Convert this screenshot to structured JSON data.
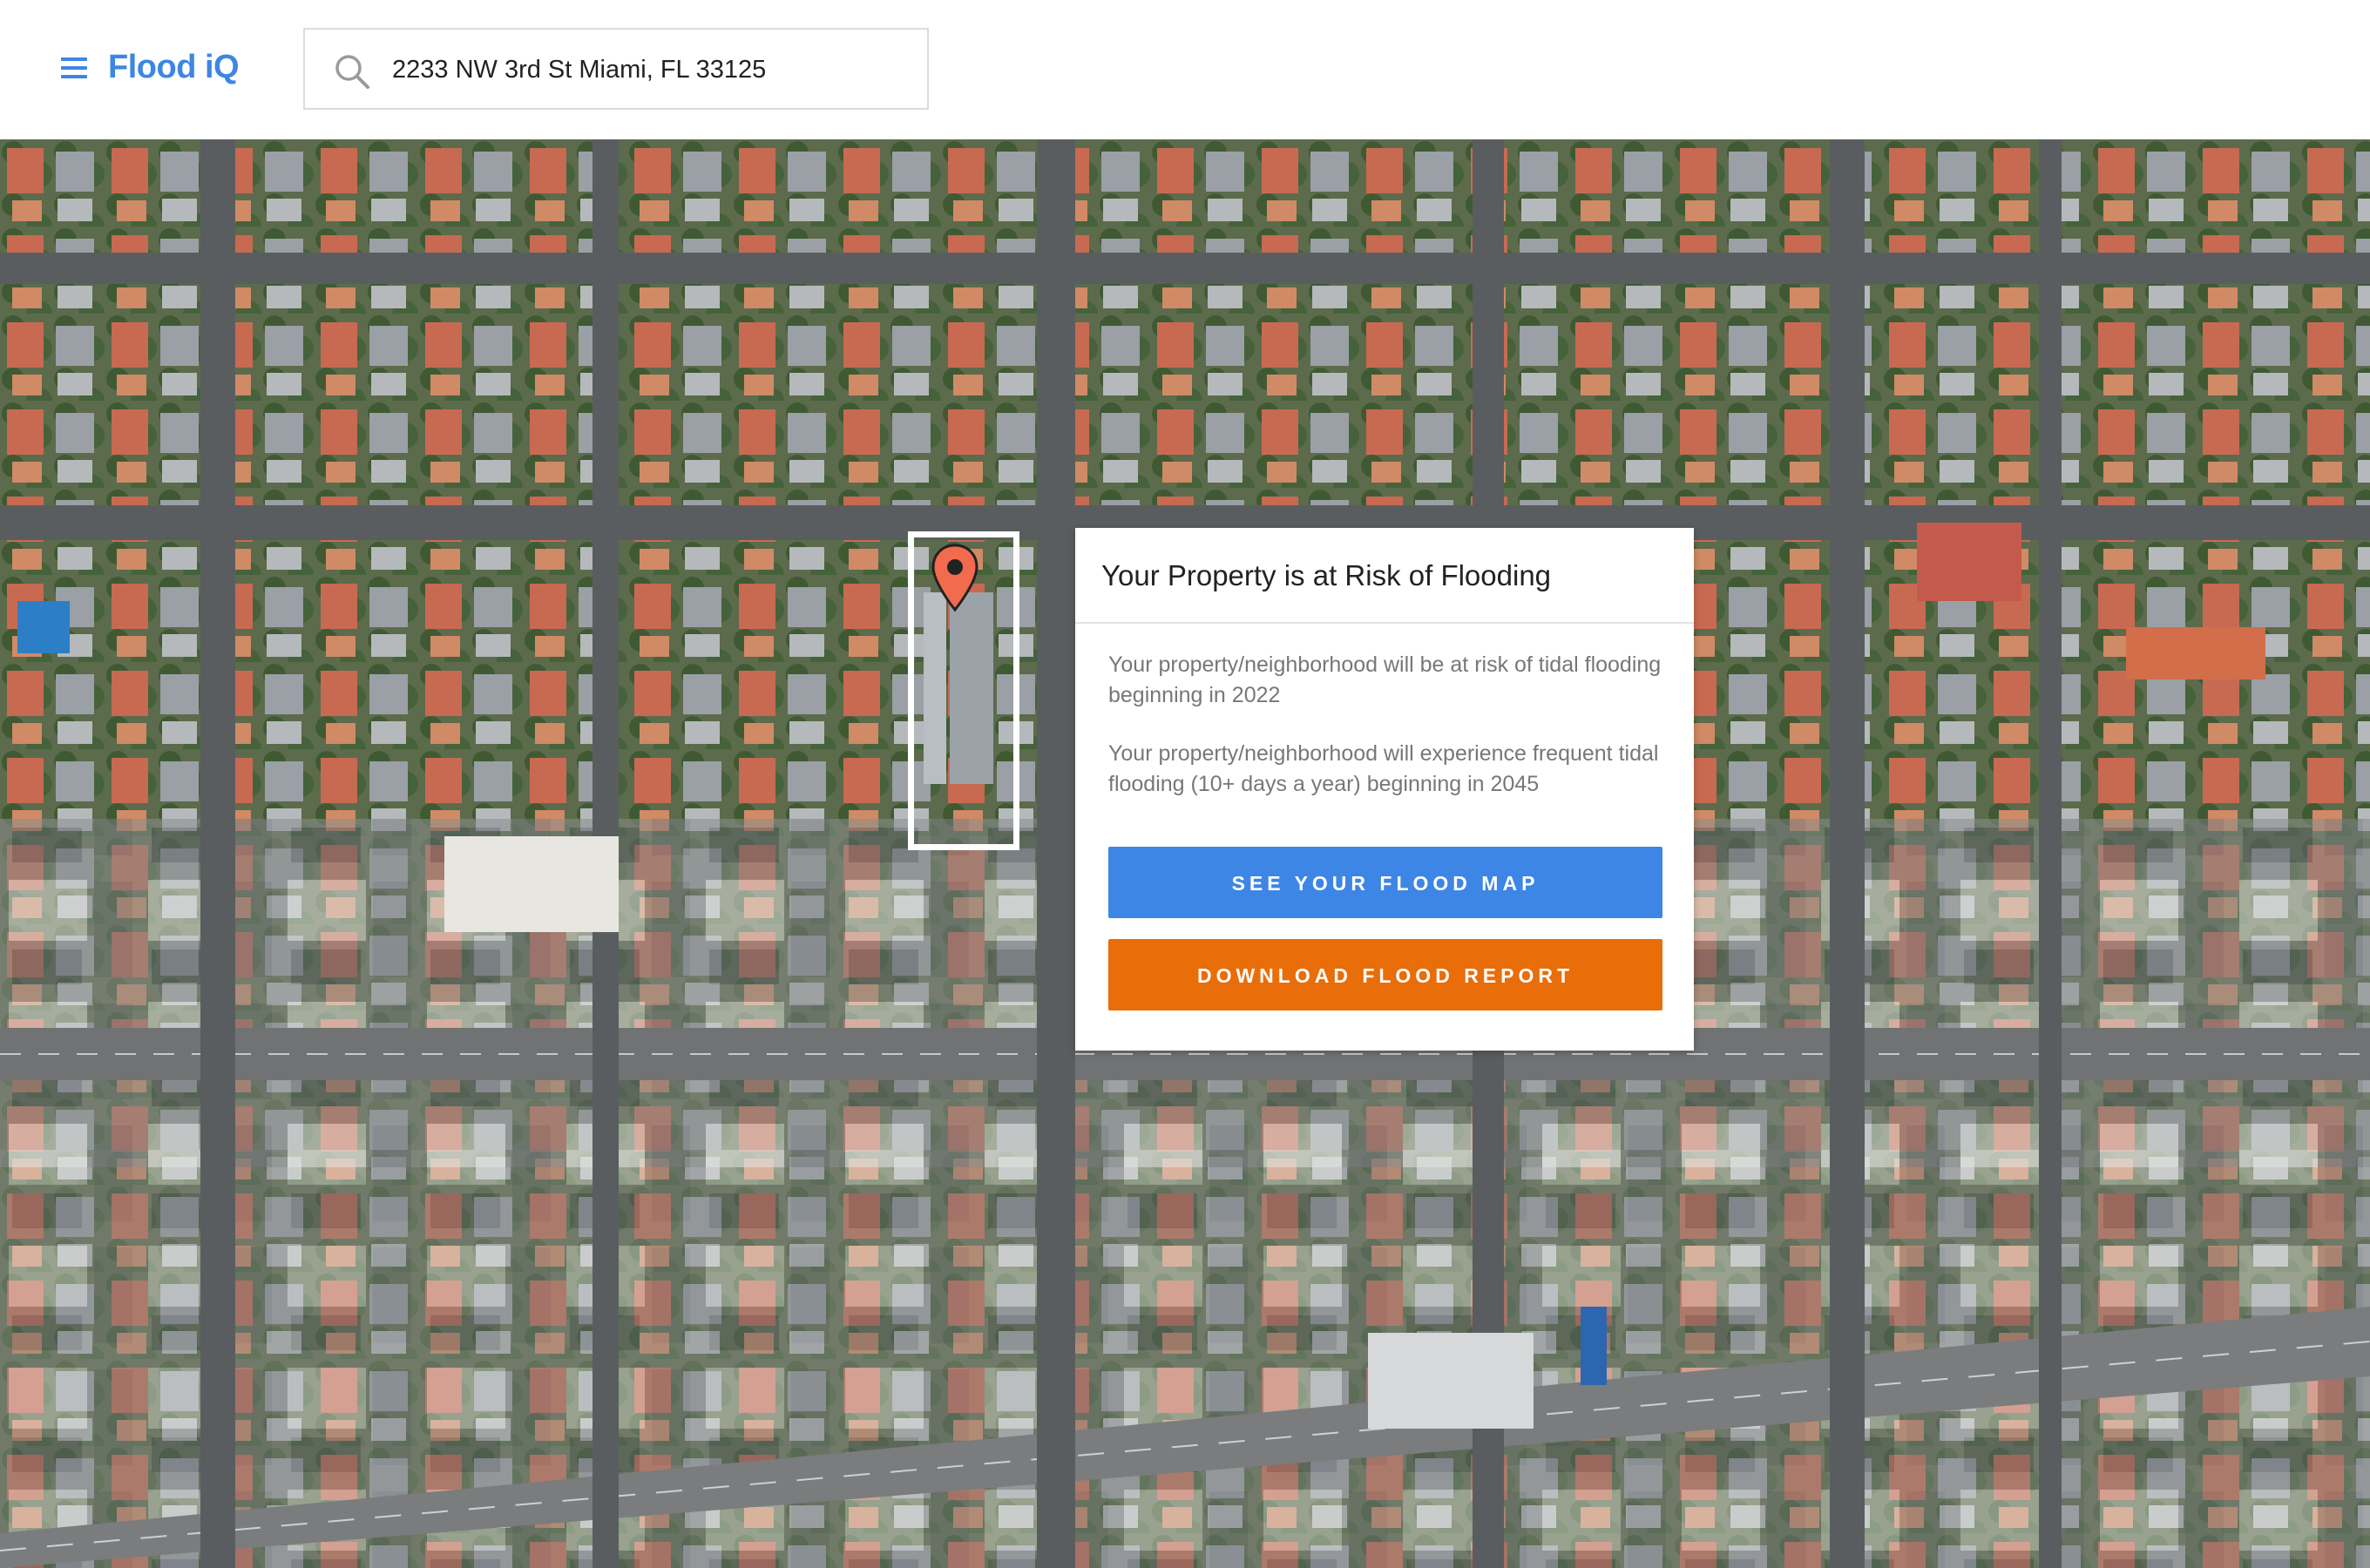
{
  "app": {
    "name": "Flood iQ"
  },
  "header": {
    "menu_icon": "hamburger-menu-icon",
    "search_icon": "search-icon"
  },
  "search": {
    "value": "2233 NW 3rd St Miami, FL 33125"
  },
  "map": {
    "view": "satellite",
    "marker_icon": "location-pin-icon",
    "marker_color": "#f26b4f"
  },
  "card": {
    "title": "Your Property is at Risk of Flooding",
    "line1": "Your property/neighborhood will be at risk of tidal flooding beginning in 2022",
    "line2": "Your property/neighborhood will experience frequent tidal flooding (10+ days a year) beginning in 2045",
    "primary_button": "SEE YOUR FLOOD MAP",
    "secondary_button": "DOWNLOAD FLOOD REPORT"
  },
  "colors": {
    "brand": "#3d86e5",
    "primary_button": "#3d86e5",
    "secondary_button": "#e96d09"
  }
}
